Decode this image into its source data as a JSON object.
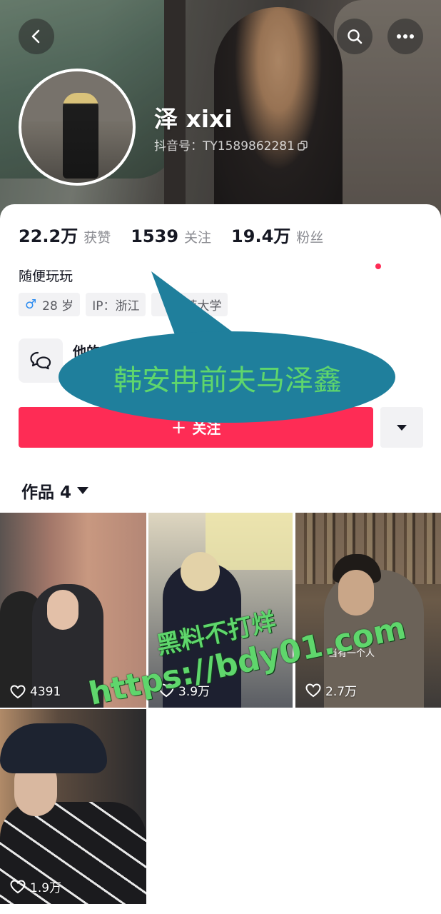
{
  "header": {
    "nickname": "泽 xixi",
    "douyin_id": "抖音号：TY1589862281",
    "back_icon": "back-arrow",
    "search_icon": "search",
    "more_icon": "more-dots"
  },
  "stats": [
    {
      "value": "22.2万",
      "label": "获赞"
    },
    {
      "value": "1539",
      "label": "关注"
    },
    {
      "value": "19.4万",
      "label": "粉丝"
    }
  ],
  "bio": "随便玩玩",
  "tags": {
    "gender_age": "28 岁",
    "ip": "IP：浙江",
    "school": "师范大学"
  },
  "message": {
    "label": "他的"
  },
  "follow": {
    "label": "关注"
  },
  "works": {
    "tab_label": "作品 4",
    "items": [
      {
        "likes": "4391"
      },
      {
        "likes": "3.9万"
      },
      {
        "likes": "2.7万"
      },
      {
        "likes": "1.9万"
      }
    ]
  },
  "overlays": {
    "bubble_text": "韩安冉前夫马泽鑫",
    "watermark_line1": "黑料不打烊",
    "watermark_line2": "https://bdy01.com",
    "video_caption": "当有一个人"
  },
  "colors": {
    "accent": "#fe2c55",
    "bubble": "#1f7f9c",
    "watermark": "#5fd66c"
  }
}
